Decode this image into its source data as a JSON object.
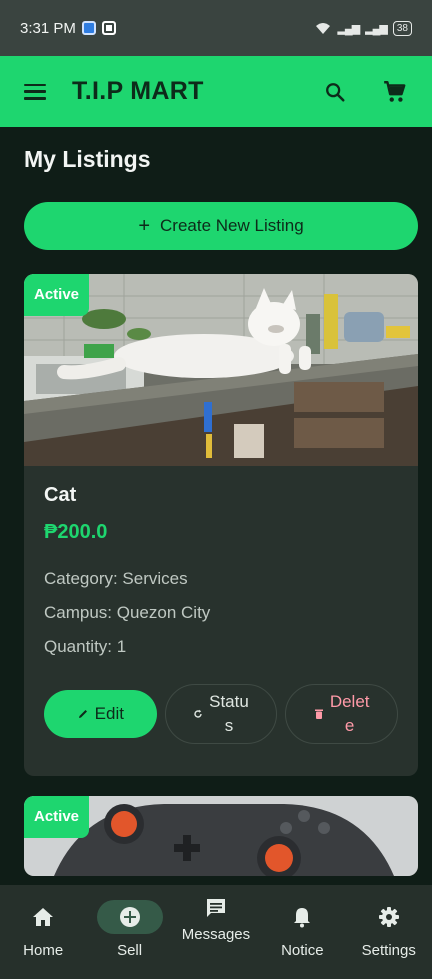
{
  "status_bar": {
    "time": "3:31 PM",
    "battery": "38"
  },
  "app_bar": {
    "title": "T.I.P MART"
  },
  "page": {
    "title": "My Listings",
    "create_label": "Create New Listing"
  },
  "listings": [
    {
      "status": "Active",
      "title": "Cat",
      "price": "₱200.0",
      "category": "Category: Services",
      "campus": "Campus: Quezon City",
      "quantity": "Quantity: 1",
      "edit_label": "Edit",
      "status_label": "Status",
      "delete_label": "Delete"
    },
    {
      "status": "Active"
    }
  ],
  "bottom_nav": {
    "home": "Home",
    "sell": "Sell",
    "messages": "Messages",
    "notice": "Notice",
    "settings": "Settings"
  },
  "colors": {
    "accent": "#1ed66f",
    "background": "#0f1d17",
    "card": "#28322d",
    "delete": "#ff9aa8"
  }
}
